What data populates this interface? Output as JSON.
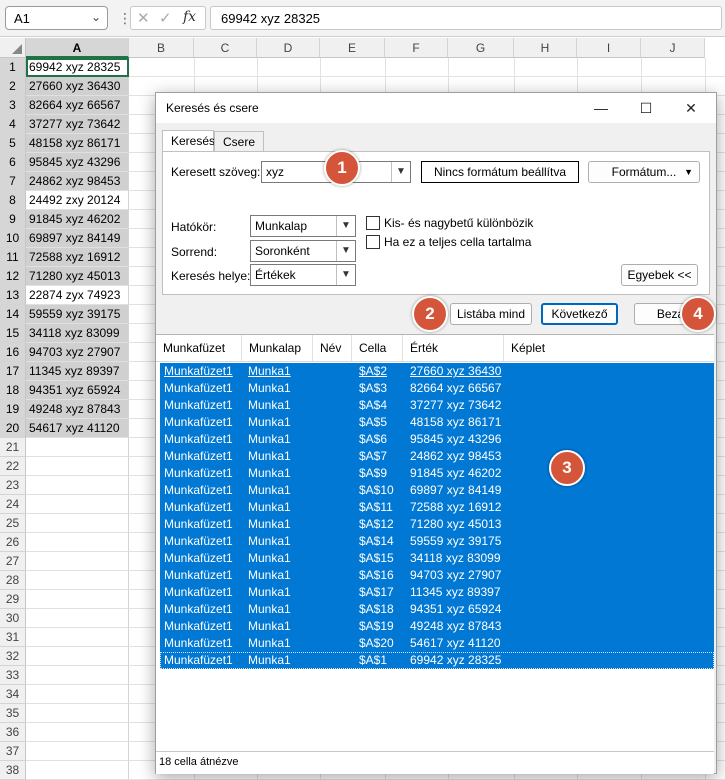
{
  "formula_bar": {
    "name_box": "A1",
    "fx_label": "fx",
    "formula": "69942 xyz 28325"
  },
  "sheet": {
    "columns": [
      "A",
      "B",
      "C",
      "D",
      "E",
      "F",
      "G",
      "H",
      "I",
      "J"
    ],
    "rows": [
      "1",
      "2",
      "3",
      "4",
      "5",
      "6",
      "7",
      "8",
      "9",
      "10",
      "11",
      "12",
      "13",
      "14",
      "15",
      "16",
      "17",
      "18",
      "19",
      "20",
      "21",
      "22",
      "23",
      "24",
      "25",
      "26",
      "27",
      "28",
      "29",
      "30",
      "31",
      "32",
      "33",
      "34",
      "35",
      "36",
      "37",
      "38"
    ],
    "cells_a": [
      "69942 xyz 28325",
      "27660 xyz 36430",
      "82664 xyz 66567",
      "37277 xyz 73642",
      "48158 xyz 86171",
      "95845 xyz 43296",
      "24862 xyz 98453",
      "24492 zxy 20124",
      "91845 xyz 46202",
      "69897 xyz 84149",
      "72588 xyz 16912",
      "71280 xyz 45013",
      "22874 zyx 74923",
      "59559 xyz 39175",
      "34118 xyz 83099",
      "94703 xyz 27907",
      "11345 xyz 89397",
      "94351 xyz 65924",
      "49248 xyz 87843",
      "54617 xyz 41120"
    ]
  },
  "dialog": {
    "title": "Keresés és csere",
    "tabs": [
      "Keresés",
      "Csere"
    ],
    "search_label": "Keresett szöveg:",
    "search_value": "xyz",
    "no_format": "Nincs formátum beállítva",
    "format_button": "Formátum...",
    "scope_label": "Hatókör:",
    "scope_value": "Munkalap",
    "order_label": "Sorrend:",
    "order_value": "Soronként",
    "lookin_label": "Keresés helye:",
    "lookin_value": "Értékek",
    "match_case": "Kis- és nagybetű különbözik",
    "entire_cell": "Ha ez a teljes cella tartalma",
    "options_button": "Egyebek <<",
    "find_all": "Listába mind",
    "find_next": "Következő",
    "close": "Bezár",
    "columns": [
      "Munkafüzet",
      "Munkalap",
      "Név",
      "Cella",
      "Érték",
      "Képlet"
    ],
    "results": [
      {
        "book": "Munkafüzet1",
        "sheet": "Munka1",
        "cell": "$A$2",
        "value": "27660 xyz 36430"
      },
      {
        "book": "Munkafüzet1",
        "sheet": "Munka1",
        "cell": "$A$3",
        "value": "82664 xyz 66567"
      },
      {
        "book": "Munkafüzet1",
        "sheet": "Munka1",
        "cell": "$A$4",
        "value": "37277 xyz 73642"
      },
      {
        "book": "Munkafüzet1",
        "sheet": "Munka1",
        "cell": "$A$5",
        "value": "48158 xyz 86171"
      },
      {
        "book": "Munkafüzet1",
        "sheet": "Munka1",
        "cell": "$A$6",
        "value": "95845 xyz 43296"
      },
      {
        "book": "Munkafüzet1",
        "sheet": "Munka1",
        "cell": "$A$7",
        "value": "24862 xyz 98453"
      },
      {
        "book": "Munkafüzet1",
        "sheet": "Munka1",
        "cell": "$A$9",
        "value": "91845 xyz 46202"
      },
      {
        "book": "Munkafüzet1",
        "sheet": "Munka1",
        "cell": "$A$10",
        "value": "69897 xyz 84149"
      },
      {
        "book": "Munkafüzet1",
        "sheet": "Munka1",
        "cell": "$A$11",
        "value": "72588 xyz 16912"
      },
      {
        "book": "Munkafüzet1",
        "sheet": "Munka1",
        "cell": "$A$12",
        "value": "71280 xyz 45013"
      },
      {
        "book": "Munkafüzet1",
        "sheet": "Munka1",
        "cell": "$A$14",
        "value": "59559 xyz 39175"
      },
      {
        "book": "Munkafüzet1",
        "sheet": "Munka1",
        "cell": "$A$15",
        "value": "34118 xyz 83099"
      },
      {
        "book": "Munkafüzet1",
        "sheet": "Munka1",
        "cell": "$A$16",
        "value": "94703 xyz 27907"
      },
      {
        "book": "Munkafüzet1",
        "sheet": "Munka1",
        "cell": "$A$17",
        "value": "11345 xyz 89397"
      },
      {
        "book": "Munkafüzet1",
        "sheet": "Munka1",
        "cell": "$A$18",
        "value": "94351 xyz 65924"
      },
      {
        "book": "Munkafüzet1",
        "sheet": "Munka1",
        "cell": "$A$19",
        "value": "49248 xyz 87843"
      },
      {
        "book": "Munkafüzet1",
        "sheet": "Munka1",
        "cell": "$A$20",
        "value": "54617 xyz 41120"
      },
      {
        "book": "Munkafüzet1",
        "sheet": "Munka1",
        "cell": "$A$1",
        "value": "69942 xyz 28325"
      }
    ],
    "status": "18 cella átnézve"
  },
  "callouts": [
    "1",
    "2",
    "3",
    "4"
  ],
  "colors": {
    "selection": "#0078d4",
    "badge": "#d4553a",
    "excel_green": "#217346"
  }
}
